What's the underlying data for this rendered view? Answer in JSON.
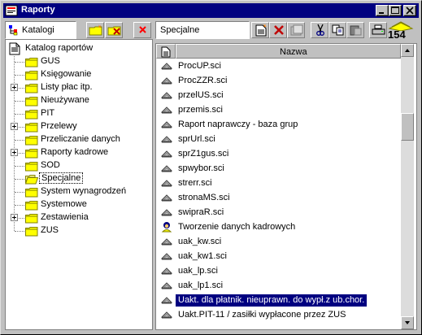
{
  "window": {
    "title": "Raporty"
  },
  "titlebar_buttons": [
    "minimize",
    "maximize",
    "close"
  ],
  "left_panel": {
    "label": "Katalogi",
    "tree_root": "Katalog raportów",
    "tree_items": [
      {
        "label": "GUS",
        "expandable": false
      },
      {
        "label": "Księgowanie",
        "expandable": false
      },
      {
        "label": "Listy płac itp.",
        "expandable": true
      },
      {
        "label": "Nieużywane",
        "expandable": false
      },
      {
        "label": "PIT",
        "expandable": false
      },
      {
        "label": "Przelewy",
        "expandable": true
      },
      {
        "label": "Przeliczanie danych",
        "expandable": false
      },
      {
        "label": "Raporty kadrowe",
        "expandable": true
      },
      {
        "label": "SOD",
        "expandable": false
      },
      {
        "label": "Specjalne",
        "expandable": false,
        "selected": true
      },
      {
        "label": "System wynagrodzeń",
        "expandable": false
      },
      {
        "label": "Systemowe",
        "expandable": false
      },
      {
        "label": "Zestawienia",
        "expandable": true
      },
      {
        "label": "ZUS",
        "expandable": false
      }
    ]
  },
  "right_panel": {
    "current_folder": "Specjalne",
    "toolbar_badge": "154",
    "column_header": "Nazwa",
    "items": [
      {
        "label": "ProcUP.sci",
        "icon": "report-icon"
      },
      {
        "label": "ProcZZR.sci",
        "icon": "report-icon"
      },
      {
        "label": "przelUS.sci",
        "icon": "report-icon"
      },
      {
        "label": "przemis.sci",
        "icon": "report-icon"
      },
      {
        "label": "Raport naprawczy - baza grup",
        "icon": "report-icon"
      },
      {
        "label": "sprUrl.sci",
        "icon": "report-icon"
      },
      {
        "label": "sprZ1gus.sci",
        "icon": "report-icon"
      },
      {
        "label": "spwybor.sci",
        "icon": "report-icon"
      },
      {
        "label": "strerr.sci",
        "icon": "report-icon"
      },
      {
        "label": "stronaMS.sci",
        "icon": "report-icon"
      },
      {
        "label": "swipraR.sci",
        "icon": "report-icon"
      },
      {
        "label": "Tworzenie danych kadrowych",
        "icon": "wizard-icon"
      },
      {
        "label": "uak_kw.sci",
        "icon": "report-icon"
      },
      {
        "label": "uak_kw1.sci",
        "icon": "report-icon"
      },
      {
        "label": "uak_lp.sci",
        "icon": "report-icon"
      },
      {
        "label": "uak_lp1.sci",
        "icon": "report-icon"
      },
      {
        "label": "Uakt. dla płatnik. nieuprawn. do wypł.z ub.chor.",
        "icon": "report-icon",
        "selected": true
      },
      {
        "label": "Uakt.PIT-11 / zasiłki wypłacone przez ZUS",
        "icon": "report-icon"
      }
    ]
  },
  "colors": {
    "titlebar": "#000080",
    "face": "#c0c0c0",
    "selection": "#000080",
    "folder": "#ffff00"
  }
}
